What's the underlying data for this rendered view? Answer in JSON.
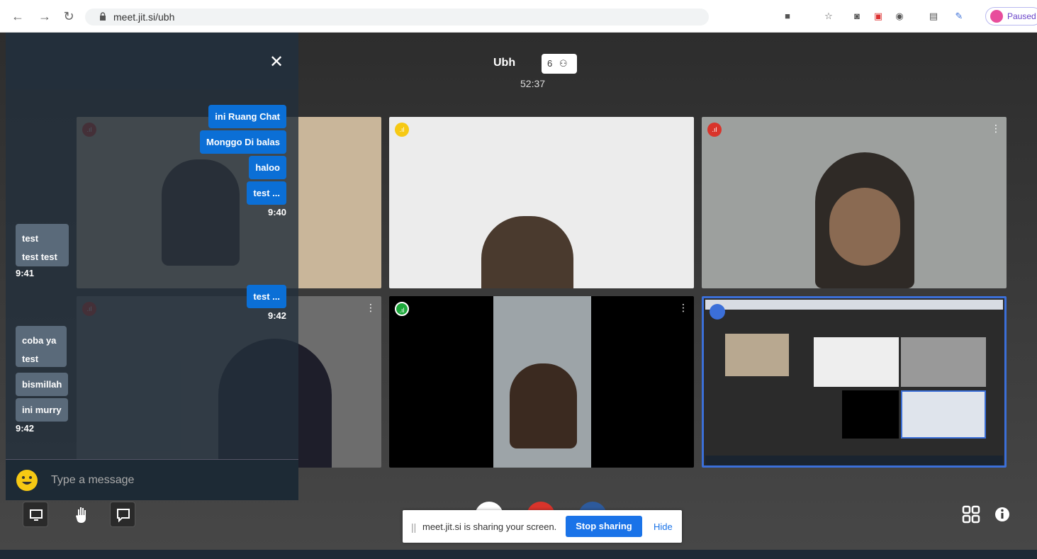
{
  "browser": {
    "url": "meet.jit.si/ubh",
    "profile_label": "Paused",
    "icons": [
      "back-icon",
      "forward-icon",
      "reload-icon",
      "lock-icon",
      "camera-icon",
      "star-icon",
      "screenshot-icon",
      "extension-icon",
      "extension-icon",
      "extension-icon",
      "extension-icon"
    ]
  },
  "meeting": {
    "title": "Ubh",
    "participant_count": "6",
    "timer": "52:37"
  },
  "chat": {
    "input_placeholder": "Type a message",
    "messages": [
      {
        "side": "me",
        "text": "ini Ruang Chat"
      },
      {
        "side": "me",
        "text": "Monggo Di balas"
      },
      {
        "side": "me",
        "text": "haloo"
      },
      {
        "side": "me",
        "text": "test ..."
      },
      {
        "side": "me",
        "time": "9:40"
      },
      {
        "side": "them",
        "text": "test"
      },
      {
        "side": "them",
        "text": "test test"
      },
      {
        "side": "them",
        "time": "9:41"
      },
      {
        "side": "me",
        "text": "test ..."
      },
      {
        "side": "me",
        "time": "9:42"
      },
      {
        "side": "them",
        "text": "coba ya"
      },
      {
        "side": "them",
        "text": "test"
      },
      {
        "side": "them",
        "text": "bismillah"
      },
      {
        "side": "them",
        "text": "ini murry"
      },
      {
        "side": "them",
        "time": "9:42"
      }
    ]
  },
  "share_bar": {
    "message": "meet.jit.si is sharing your screen.",
    "stop_label": "Stop sharing",
    "hide_label": "Hide"
  },
  "colors": {
    "accent": "#1a73e8",
    "my_bubble": "#0b6fd6",
    "their_bubble": "#5a6a7a",
    "indicator_red": "#d9342b",
    "indicator_yellow": "#f6c914",
    "indicator_green": "#1da83b"
  }
}
